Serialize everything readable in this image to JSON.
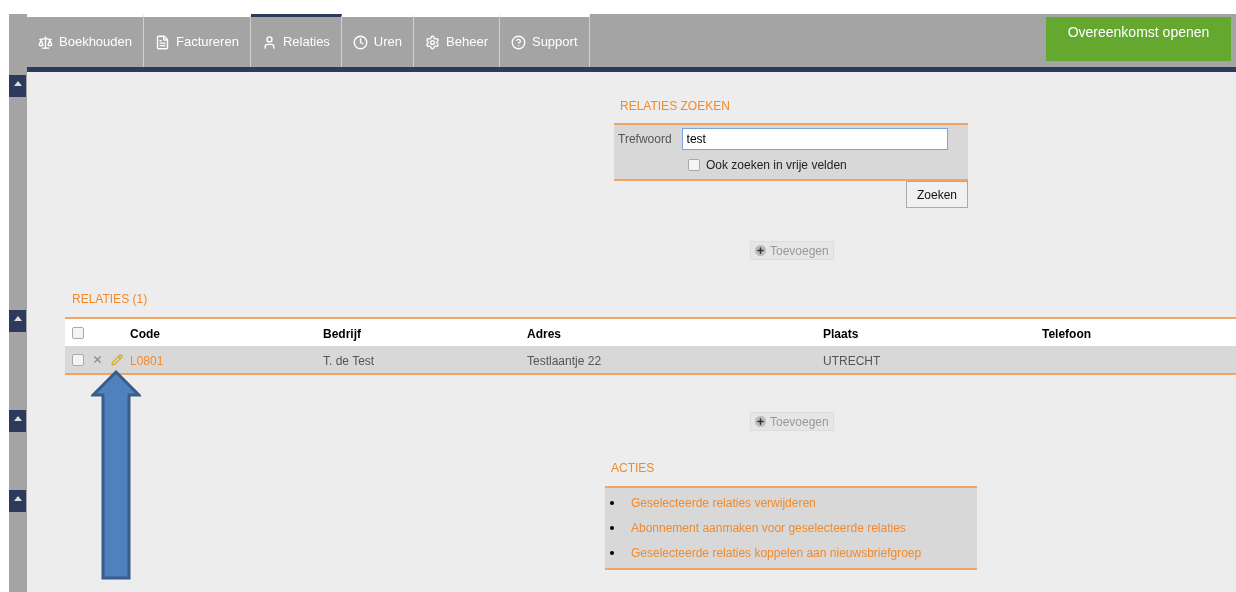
{
  "nav": {
    "tabs": [
      {
        "label": "Boekhouden",
        "selected": false
      },
      {
        "label": "Factureren",
        "selected": false
      },
      {
        "label": "Relaties",
        "selected": true
      },
      {
        "label": "Uren",
        "selected": false
      },
      {
        "label": "Beheer",
        "selected": false
      },
      {
        "label": "Support",
        "selected": false
      }
    ],
    "action_button": "Overeenkomst openen"
  },
  "search": {
    "title": "RELATIES ZOEKEN",
    "field_label": "Trefwoord",
    "value": "test",
    "checkbox": {
      "label": "Ook zoeken in vrije velden",
      "checked": false
    },
    "button": "Zoeken"
  },
  "add_button_top": "Toevoegen",
  "table": {
    "title": "RELATIES (1)",
    "header_checked": false,
    "columns": [
      "Code",
      "Bedrijf",
      "Adres",
      "Plaats",
      "Telefoon"
    ],
    "rows": [
      {
        "checked": false,
        "code": "L0801",
        "company": "T. de Test",
        "address": "Testlaantje 22",
        "city": "UTRECHT"
      }
    ]
  },
  "add_button_bottom": "Toevoegen",
  "actions": {
    "title": "ACTIES",
    "items": [
      "Geselecteerde relaties verwijderen",
      "Abonnement aanmaken voor geselecteerde relaties",
      "Geselecteerde relaties koppelen aan nieuwsbriefgroep"
    ]
  }
}
